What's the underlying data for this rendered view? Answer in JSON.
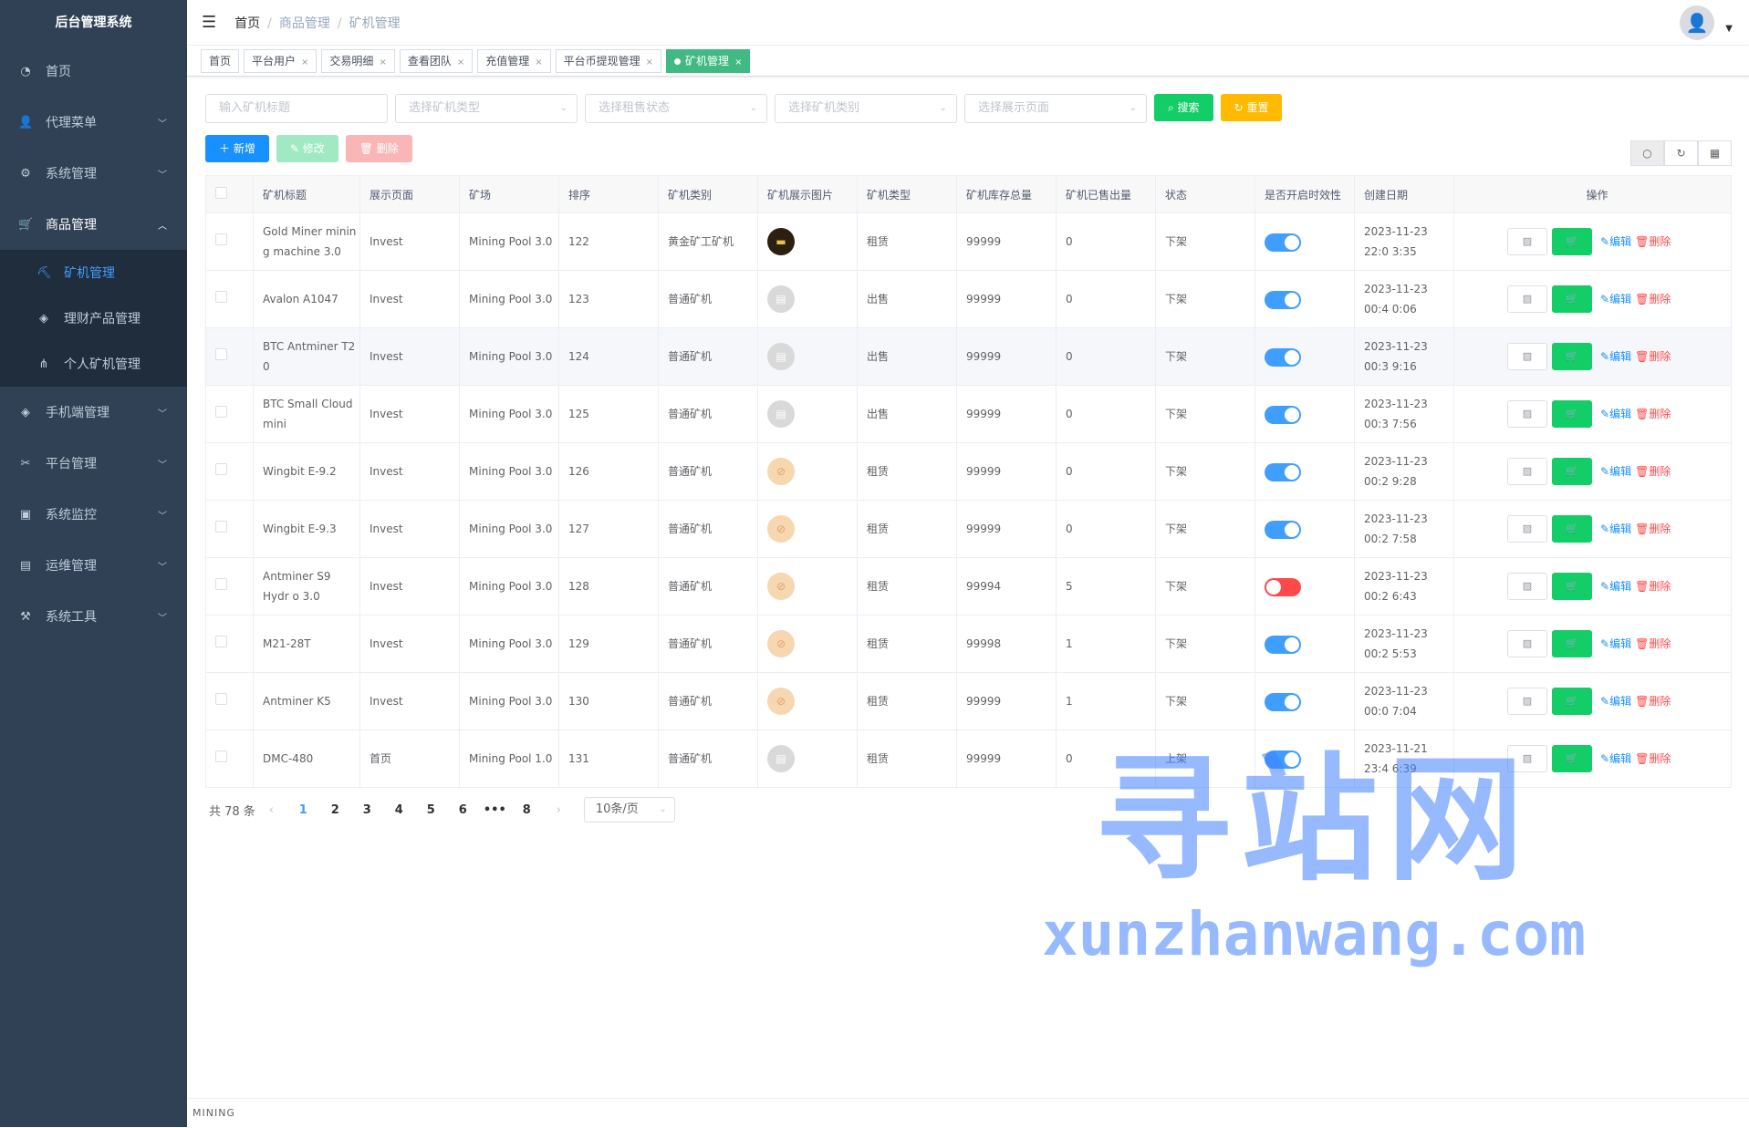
{
  "app_title": "后台管理系统",
  "sidebar": {
    "items": [
      {
        "label": "首页",
        "icon": "dashboard-icon"
      },
      {
        "label": "代理菜单",
        "icon": "user-icon"
      },
      {
        "label": "系统管理",
        "icon": "gear-icon"
      },
      {
        "label": "商品管理",
        "icon": "cart-icon"
      },
      {
        "label": "矿机管理",
        "icon": "mining-icon"
      },
      {
        "label": "理财产品管理",
        "icon": "cube-icon"
      },
      {
        "label": "个人矿机管理",
        "icon": "tree-icon"
      },
      {
        "label": "手机端管理",
        "icon": "cube-icon"
      },
      {
        "label": "平台管理",
        "icon": "tool-icon"
      },
      {
        "label": "系统监控",
        "icon": "monitor-icon"
      },
      {
        "label": "运维管理",
        "icon": "server-icon"
      },
      {
        "label": "系统工具",
        "icon": "toolbox-icon"
      }
    ]
  },
  "breadcrumb": {
    "home": "首页",
    "level1": "商品管理",
    "level2": "矿机管理"
  },
  "tags": [
    "首页",
    "平台用户",
    "交易明细",
    "查看团队",
    "充值管理",
    "平台币提现管理",
    "矿机管理"
  ],
  "filters": {
    "title_placeholder": "输入矿机标题",
    "type_placeholder": "选择矿机类型",
    "rent_placeholder": "选择租售状态",
    "category_placeholder": "选择矿机类别",
    "page_placeholder": "选择展示页面",
    "search_label": "搜索",
    "reset_label": "重置"
  },
  "toolbar": {
    "add": "新增",
    "edit": "修改",
    "delete": "删除"
  },
  "table": {
    "headers": [
      "矿机标题",
      "展示页面",
      "矿场",
      "排序",
      "矿机类别",
      "矿机展示图片",
      "矿机类型",
      "矿机库存总量",
      "矿机已售出量",
      "状态",
      "是否开启时效性",
      "创建日期",
      "操作"
    ],
    "edit_label": "编辑",
    "delete_label": "删除",
    "rows": [
      {
        "title": "Gold Miner minin g machine 3.0",
        "page": "Invest",
        "pool": "Mining Pool 3.0",
        "sort": "122",
        "category": "黄金矿工矿机",
        "img": "gold",
        "type": "租赁",
        "stock": "99999",
        "sold": "0",
        "status": "下架",
        "timed": true,
        "date": "2023-11-23 22:0 3:35"
      },
      {
        "title": "Avalon A1047",
        "page": "Invest",
        "pool": "Mining Pool 3.0",
        "sort": "123",
        "category": "普通矿机",
        "img": "doc",
        "type": "出售",
        "stock": "99999",
        "sold": "0",
        "status": "下架",
        "timed": true,
        "date": "2023-11-23 00:4 0:06"
      },
      {
        "title": "BTC Antminer T2 0",
        "page": "Invest",
        "pool": "Mining Pool 3.0",
        "sort": "124",
        "category": "普通矿机",
        "img": "doc",
        "type": "出售",
        "stock": "99999",
        "sold": "0",
        "status": "下架",
        "timed": true,
        "date": "2023-11-23 00:3 9:16"
      },
      {
        "title": "BTC Small Cloud mini",
        "page": "Invest",
        "pool": "Mining Pool 3.0",
        "sort": "125",
        "category": "普通矿机",
        "img": "doc",
        "type": "出售",
        "stock": "99999",
        "sold": "0",
        "status": "下架",
        "timed": true,
        "date": "2023-11-23 00:3 7:56"
      },
      {
        "title": "Wingbit E-9.2",
        "page": "Invest",
        "pool": "Mining Pool 3.0",
        "sort": "126",
        "category": "普通矿机",
        "img": "ban",
        "type": "租赁",
        "stock": "99999",
        "sold": "0",
        "status": "下架",
        "timed": true,
        "date": "2023-11-23 00:2 9:28"
      },
      {
        "title": "Wingbit E-9.3",
        "page": "Invest",
        "pool": "Mining Pool 3.0",
        "sort": "127",
        "category": "普通矿机",
        "img": "ban",
        "type": "租赁",
        "stock": "99999",
        "sold": "0",
        "status": "下架",
        "timed": true,
        "date": "2023-11-23 00:2 7:58"
      },
      {
        "title": "Antminer S9 Hydr o 3.0",
        "page": "Invest",
        "pool": "Mining Pool 3.0",
        "sort": "128",
        "category": "普通矿机",
        "img": "ban",
        "type": "租赁",
        "stock": "99994",
        "sold": "5",
        "status": "下架",
        "timed": false,
        "date": "2023-11-23 00:2 6:43"
      },
      {
        "title": "M21-28T",
        "page": "Invest",
        "pool": "Mining Pool 3.0",
        "sort": "129",
        "category": "普通矿机",
        "img": "ban",
        "type": "租赁",
        "stock": "99998",
        "sold": "1",
        "status": "下架",
        "timed": true,
        "date": "2023-11-23 00:2 5:53"
      },
      {
        "title": "Antminer K5",
        "page": "Invest",
        "pool": "Mining Pool 3.0",
        "sort": "130",
        "category": "普通矿机",
        "img": "ban",
        "type": "租赁",
        "stock": "99999",
        "sold": "1",
        "status": "下架",
        "timed": true,
        "date": "2023-11-23 00:0 7:04"
      },
      {
        "title": "DMC-480",
        "page": "首页",
        "pool": "Mining Pool 1.0",
        "sort": "131",
        "category": "普通矿机",
        "img": "doc",
        "type": "租赁",
        "stock": "99999",
        "sold": "0",
        "status": "上架",
        "timed": true,
        "date": "2023-11-21 23:4 6:39"
      }
    ]
  },
  "pagination": {
    "total": "共 78 条",
    "pages": [
      "1",
      "2",
      "3",
      "4",
      "5",
      "6",
      "•••",
      "8"
    ],
    "current": "1",
    "size": "10条/页"
  },
  "footer": "MINING",
  "watermark": {
    "big": "寻站网",
    "small": "xunzhanwang.com"
  },
  "colors": {
    "sidebar": "#304156",
    "primary": "#1890ff",
    "success": "#13ce66",
    "warning": "#ffba00",
    "danger": "#ff4949",
    "tag_active": "#42b983"
  }
}
